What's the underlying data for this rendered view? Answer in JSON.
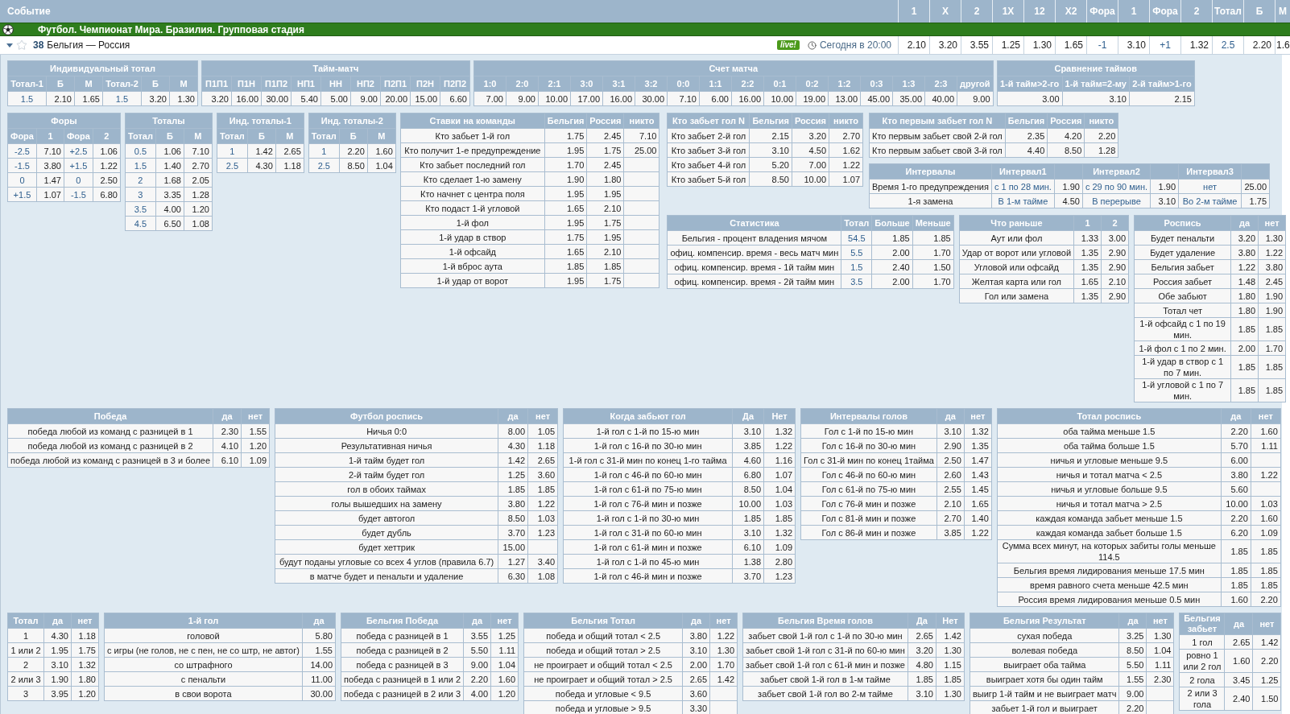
{
  "header": {
    "title": "Событие",
    "columns": [
      "1",
      "X",
      "2",
      "1X",
      "12",
      "X2",
      "Фора",
      "1",
      "Фора",
      "2",
      "Тотал",
      "Б",
      "М"
    ]
  },
  "league": {
    "name": "Футбол. Чемпионат Мира. Бразилия. Групповая стадия"
  },
  "event": {
    "expanded": true,
    "favorite": false,
    "number": "38",
    "teams": "Бельгия — Россия",
    "live": "live!",
    "time": "Сегодня в 20:00",
    "odds": [
      {
        "value": "2.10",
        "kind": "odds"
      },
      {
        "value": "3.20",
        "kind": "odds"
      },
      {
        "value": "3.55",
        "kind": "odds"
      },
      {
        "value": "1.25",
        "kind": "odds"
      },
      {
        "value": "1.30",
        "kind": "odds"
      },
      {
        "value": "1.65",
        "kind": "odds"
      },
      {
        "value": "-1",
        "kind": "param"
      },
      {
        "value": "3.10",
        "kind": "odds"
      },
      {
        "value": "+1",
        "kind": "param"
      },
      {
        "value": "1.32",
        "kind": "odds"
      },
      {
        "value": "2.5",
        "kind": "param"
      },
      {
        "value": "2.20",
        "kind": "odds"
      },
      {
        "value": "1.6",
        "kind": "odds"
      }
    ]
  },
  "markets": [
    {
      "title": "Индивидуальный тотал",
      "kind": "stacked",
      "columns": [
        {
          "label": "Тотал-1",
          "kind": "param"
        },
        {
          "label": "Б",
          "kind": "odds"
        },
        {
          "label": "М",
          "kind": "odds"
        },
        {
          "label": "Тотал-2",
          "kind": "param"
        },
        {
          "label": "Б",
          "kind": "odds"
        },
        {
          "label": "М",
          "kind": "odds"
        }
      ],
      "rows": [
        [
          "1.5",
          "2.10",
          "1.65",
          "1.5",
          "3.20",
          "1.30"
        ]
      ]
    },
    {
      "title": "Тайм-матч",
      "kind": "stacked",
      "columns": [
        {
          "label": "П1П1",
          "kind": "odds"
        },
        {
          "label": "П1Н",
          "kind": "odds"
        },
        {
          "label": "П1П2",
          "kind": "odds"
        },
        {
          "label": "НП1",
          "kind": "odds"
        },
        {
          "label": "НН",
          "kind": "odds"
        },
        {
          "label": "НП2",
          "kind": "odds"
        },
        {
          "label": "П2П1",
          "kind": "odds"
        },
        {
          "label": "П2Н",
          "kind": "odds"
        },
        {
          "label": "П2П2",
          "kind": "odds"
        }
      ],
      "rows": [
        [
          "3.20",
          "16.00",
          "30.00",
          "5.40",
          "5.00",
          "9.00",
          "20.00",
          "15.00",
          "6.60"
        ]
      ]
    },
    {
      "title": "Счет матча",
      "kind": "stacked",
      "columns": [
        {
          "label": "1:0",
          "kind": "odds"
        },
        {
          "label": "2:0",
          "kind": "odds"
        },
        {
          "label": "2:1",
          "kind": "odds"
        },
        {
          "label": "3:0",
          "kind": "odds"
        },
        {
          "label": "3:1",
          "kind": "odds"
        },
        {
          "label": "3:2",
          "kind": "odds"
        },
        {
          "label": "0:0",
          "kind": "odds"
        },
        {
          "label": "1:1",
          "kind": "odds"
        },
        {
          "label": "2:2",
          "kind": "odds"
        },
        {
          "label": "0:1",
          "kind": "odds"
        },
        {
          "label": "0:2",
          "kind": "odds"
        },
        {
          "label": "1:2",
          "kind": "odds"
        },
        {
          "label": "0:3",
          "kind": "odds"
        },
        {
          "label": "1:3",
          "kind": "odds"
        },
        {
          "label": "2:3",
          "kind": "odds"
        },
        {
          "label": "другой",
          "kind": "odds"
        }
      ],
      "rows": [
        [
          "7.00",
          "9.00",
          "10.00",
          "17.00",
          "16.00",
          "30.00",
          "7.10",
          "6.00",
          "16.00",
          "10.00",
          "19.00",
          "13.00",
          "45.00",
          "35.00",
          "40.00",
          "9.00"
        ]
      ]
    },
    {
      "title": "Сравнение таймов",
      "kind": "stacked",
      "columns": [
        {
          "label": "1-й тайм>2-го",
          "kind": "odds"
        },
        {
          "label": "1-й тайм=2-му",
          "kind": "odds"
        },
        {
          "label": "2-й тайм>1-го",
          "kind": "odds"
        }
      ],
      "rows": [
        [
          "3.00",
          "3.10",
          "2.15"
        ]
      ]
    },
    {
      "title": "Форы",
      "kind": "stacked",
      "columns": [
        {
          "label": "Фора",
          "kind": "param"
        },
        {
          "label": "1",
          "kind": "odds"
        },
        {
          "label": "Фора",
          "kind": "param"
        },
        {
          "label": "2",
          "kind": "odds"
        }
      ],
      "rows": [
        [
          "-2.5",
          "7.10",
          "+2.5",
          "1.06"
        ],
        [
          "-1.5",
          "3.80",
          "+1.5",
          "1.22"
        ],
        [
          "0",
          "1.47",
          "0",
          "2.50"
        ],
        [
          "+1.5",
          "1.07",
          "-1.5",
          "6.80"
        ]
      ]
    },
    {
      "title": "Тоталы",
      "kind": "stacked",
      "columns": [
        {
          "label": "Тотал",
          "kind": "param"
        },
        {
          "label": "Б",
          "kind": "odds"
        },
        {
          "label": "М",
          "kind": "odds"
        }
      ],
      "rows": [
        [
          "0.5",
          "1.06",
          "7.10"
        ],
        [
          "1.5",
          "1.40",
          "2.70"
        ],
        [
          "2",
          "1.68",
          "2.05"
        ],
        [
          "3",
          "3.35",
          "1.28"
        ],
        [
          "3.5",
          "4.00",
          "1.20"
        ],
        [
          "4.5",
          "6.50",
          "1.08"
        ]
      ]
    },
    {
      "title": "Инд. тоталы-1",
      "kind": "stacked",
      "columns": [
        {
          "label": "Тотал",
          "kind": "param"
        },
        {
          "label": "Б",
          "kind": "odds"
        },
        {
          "label": "М",
          "kind": "odds"
        }
      ],
      "rows": [
        [
          "1",
          "1.42",
          "2.65"
        ],
        [
          "2.5",
          "4.30",
          "1.18"
        ]
      ]
    },
    {
      "title": "Инд. тоталы-2",
      "kind": "stacked",
      "columns": [
        {
          "label": "Тотал",
          "kind": "param"
        },
        {
          "label": "Б",
          "kind": "odds"
        },
        {
          "label": "М",
          "kind": "odds"
        }
      ],
      "rows": [
        [
          "1",
          "2.20",
          "1.60"
        ],
        [
          "2.5",
          "8.50",
          "1.04"
        ]
      ]
    },
    {
      "title": "Ставки на команды",
      "kind": "inline",
      "columns": [
        {
          "label": "Бельгия",
          "kind": "odds"
        },
        {
          "label": "Россия",
          "kind": "odds"
        },
        {
          "label": "никто",
          "kind": "odds"
        }
      ],
      "rows": [
        {
          "label": "Кто забьет 1-й гол",
          "cells": [
            "1.75",
            "2.45",
            "7.10"
          ]
        },
        {
          "label": "Кто получит 1-е предупреждение",
          "cells": [
            "1.95",
            "1.75",
            "25.00"
          ]
        },
        {
          "label": "Кто забьет последний гол",
          "cells": [
            "1.70",
            "2.45",
            null
          ]
        },
        {
          "label": "Кто сделает 1-ю замену",
          "cells": [
            "1.90",
            "1.80",
            null
          ]
        },
        {
          "label": "Кто начнет с центра поля",
          "cells": [
            "1.95",
            "1.95",
            null
          ]
        },
        {
          "label": "Кто подаст 1-й угловой",
          "cells": [
            "1.65",
            "2.10",
            null
          ]
        },
        {
          "label": "1-й фол",
          "cells": [
            "1.95",
            "1.75",
            null
          ]
        },
        {
          "label": "1-й удар в створ",
          "cells": [
            "1.75",
            "1.95",
            null
          ]
        },
        {
          "label": "1-й офсайд",
          "cells": [
            "1.65",
            "2.10",
            null
          ]
        },
        {
          "label": "1-й вброс аута",
          "cells": [
            "1.85",
            "1.85",
            null
          ]
        },
        {
          "label": "1-й удар от ворот",
          "cells": [
            "1.95",
            "1.75",
            null
          ]
        }
      ]
    },
    {
      "title": "Кто забьет гол N",
      "kind": "inline",
      "columns": [
        {
          "label": "Бельгия",
          "kind": "odds"
        },
        {
          "label": "Россия",
          "kind": "odds"
        },
        {
          "label": "никто",
          "kind": "odds"
        }
      ],
      "rows": [
        {
          "label": "Кто забьет 2-й гол",
          "cells": [
            "2.15",
            "3.20",
            "2.70"
          ]
        },
        {
          "label": "Кто забьет 3-й гол",
          "cells": [
            "3.10",
            "4.50",
            "1.62"
          ]
        },
        {
          "label": "Кто забьет 4-й гол",
          "cells": [
            "5.20",
            "7.00",
            "1.22"
          ]
        },
        {
          "label": "Кто забьет 5-й гол",
          "cells": [
            "8.50",
            "10.00",
            "1.07"
          ]
        }
      ]
    },
    {
      "title": "Кто первым забьет гол N",
      "kind": "inline",
      "columns": [
        {
          "label": "Бельгия",
          "kind": "odds"
        },
        {
          "label": "Россия",
          "kind": "odds"
        },
        {
          "label": "никто",
          "kind": "odds"
        }
      ],
      "rows": [
        {
          "label": "Кто первым забьет свой 2-й гол",
          "cells": [
            "2.35",
            "4.20",
            "2.20"
          ]
        },
        {
          "label": "Кто первым забьет свой 3-й гол",
          "cells": [
            "4.40",
            "8.50",
            "1.28"
          ]
        }
      ]
    },
    {
      "title": "Интервалы",
      "kind": "inline",
      "columns": [
        {
          "label": "Интервал1",
          "kind": "param"
        },
        {
          "kind": "odds"
        },
        {
          "label": "Интервал2",
          "kind": "param"
        },
        {
          "kind": "odds"
        },
        {
          "label": "Интервал3",
          "kind": "param"
        },
        {
          "kind": "odds"
        }
      ],
      "rows": [
        {
          "label": "Время 1-го предупреждения",
          "cells": [
            "с 1 по 28 мин.",
            "1.90",
            "с 29 по 90 мин.",
            "1.90",
            "нет",
            "25.00"
          ]
        },
        {
          "label": "1-я замена",
          "cells": [
            "В 1-м тайме",
            "4.50",
            "В перерыве",
            "3.10",
            "Во 2-м тайме",
            "1.75"
          ]
        }
      ]
    },
    {
      "title": "Статистика",
      "kind": "inline",
      "columns": [
        {
          "label": "Тотал",
          "kind": "param"
        },
        {
          "label": "Больше",
          "kind": "odds"
        },
        {
          "label": "Меньше",
          "kind": "odds"
        }
      ],
      "rows": [
        {
          "label": "Бельгия - процент владения мячом",
          "cells": [
            "54.5",
            "1.85",
            "1.85"
          ]
        },
        {
          "label": "офиц. компенсир. время - весь матч мин",
          "cells": [
            "5.5",
            "2.00",
            "1.70"
          ]
        },
        {
          "label": "офиц. компенсир. время - 1й тайм мин",
          "cells": [
            "1.5",
            "2.40",
            "1.50"
          ]
        },
        {
          "label": "офиц. компенсир. время - 2й тайм мин",
          "cells": [
            "3.5",
            "2.00",
            "1.70"
          ]
        }
      ]
    },
    {
      "title": "Что раньше",
      "kind": "inline",
      "columns": [
        {
          "label": "1",
          "kind": "odds"
        },
        {
          "label": "2",
          "kind": "odds"
        }
      ],
      "rows": [
        {
          "label": "Аут или фол",
          "cells": [
            "1.33",
            "3.00"
          ]
        },
        {
          "label": "Удар от ворот или угловой",
          "cells": [
            "1.35",
            "2.90"
          ]
        },
        {
          "label": "Угловой или офсайд",
          "cells": [
            "1.35",
            "2.90"
          ]
        },
        {
          "label": "Желтая карта или гол",
          "cells": [
            "1.65",
            "2.10"
          ]
        },
        {
          "label": "Гол или замена",
          "cells": [
            "1.35",
            "2.90"
          ]
        }
      ]
    },
    {
      "title": "Роспись",
      "kind": "inline",
      "columns": [
        {
          "label": "да",
          "kind": "odds"
        },
        {
          "label": "нет",
          "kind": "odds"
        }
      ],
      "rows": [
        {
          "label": "Будет пенальти",
          "cells": [
            "3.20",
            "1.30"
          ]
        },
        {
          "label": "Будет удаление",
          "cells": [
            "3.80",
            "1.22"
          ]
        },
        {
          "label": "Бельгия забьет",
          "cells": [
            "1.22",
            "3.80"
          ]
        },
        {
          "label": "Россия забьет",
          "cells": [
            "1.48",
            "2.45"
          ]
        },
        {
          "label": "Обе забьют",
          "cells": [
            "1.80",
            "1.90"
          ]
        },
        {
          "label": "Тотал чет",
          "cells": [
            "1.80",
            "1.90"
          ]
        },
        {
          "label": "1-й офсайд с 1 по 19 мин.",
          "cells": [
            "1.85",
            "1.85"
          ]
        },
        {
          "label": "1-й фол с 1 по 2 мин.",
          "cells": [
            "2.00",
            "1.70"
          ]
        },
        {
          "label": "1-й удар в створ с 1 по 7 мин.",
          "cells": [
            "1.85",
            "1.85"
          ]
        },
        {
          "label": "1-й угловой с 1 по 7 мин.",
          "cells": [
            "1.85",
            "1.85"
          ]
        }
      ]
    },
    {
      "title": "Победа",
      "kind": "inline",
      "columns": [
        {
          "label": "да",
          "kind": "odds"
        },
        {
          "label": "нет",
          "kind": "odds"
        }
      ],
      "rows": [
        {
          "label": "победа любой из команд с разницей в 1",
          "cells": [
            "2.30",
            "1.55"
          ]
        },
        {
          "label": "победа любой из команд с разницей в 2",
          "cells": [
            "4.10",
            "1.20"
          ]
        },
        {
          "label": "победа любой из команд с разницей в 3 и более",
          "cells": [
            "6.10",
            "1.09"
          ]
        }
      ]
    },
    {
      "title": "Футбол роспись",
      "kind": "inline",
      "columns": [
        {
          "label": "да",
          "kind": "odds"
        },
        {
          "label": "нет",
          "kind": "odds"
        }
      ],
      "rows": [
        {
          "label": "Ничья 0:0",
          "cells": [
            "8.00",
            "1.05"
          ]
        },
        {
          "label": "Результативная ничья",
          "cells": [
            "4.30",
            "1.18"
          ]
        },
        {
          "label": "1-й тайм будет гол",
          "cells": [
            "1.42",
            "2.65"
          ]
        },
        {
          "label": "2-й тайм будет гол",
          "cells": [
            "1.25",
            "3.60"
          ]
        },
        {
          "label": "гол в обоих таймах",
          "cells": [
            "1.85",
            "1.85"
          ]
        },
        {
          "label": "голы вышедших на замену",
          "cells": [
            "3.80",
            "1.22"
          ]
        },
        {
          "label": "будет автогол",
          "cells": [
            "8.50",
            "1.03"
          ]
        },
        {
          "label": "будет дубль",
          "cells": [
            "3.70",
            "1.23"
          ]
        },
        {
          "label": "будет хеттрик",
          "cells": [
            "15.00",
            null
          ]
        },
        {
          "label": "будут поданы угловые со всех 4 углов (правила 6.7)",
          "cells": [
            "1.27",
            "3.40"
          ]
        },
        {
          "label": "в матче будет и пенальти и удаление",
          "cells": [
            "6.30",
            "1.08"
          ]
        }
      ]
    },
    {
      "title": "Когда забьют гол",
      "kind": "inline",
      "columns": [
        {
          "label": "Да",
          "kind": "odds"
        },
        {
          "label": "Нет",
          "kind": "odds"
        }
      ],
      "rows": [
        {
          "label": "1-й гол с 1-й по 15-ю мин",
          "cells": [
            "3.10",
            "1.32"
          ]
        },
        {
          "label": "1-й гол с 16-й по 30-ю мин",
          "cells": [
            "3.85",
            "1.22"
          ]
        },
        {
          "label": "1-й гол с 31-й мин по конец 1-го тайма",
          "cells": [
            "4.60",
            "1.16"
          ]
        },
        {
          "label": "1-й гол с 46-й по 60-ю мин",
          "cells": [
            "6.80",
            "1.07"
          ]
        },
        {
          "label": "1-й гол с 61-й по 75-ю мин",
          "cells": [
            "8.50",
            "1.04"
          ]
        },
        {
          "label": "1-й гол с 76-й мин и позже",
          "cells": [
            "10.00",
            "1.03"
          ]
        },
        {
          "label": "1-й гол с 1-й по 30-ю мин",
          "cells": [
            "1.85",
            "1.85"
          ]
        },
        {
          "label": "1-й гол с 31-й по 60-ю мин",
          "cells": [
            "3.10",
            "1.32"
          ]
        },
        {
          "label": "1-й гол с 61-й мин и позже",
          "cells": [
            "6.10",
            "1.09"
          ]
        },
        {
          "label": "1-й гол с 1-й по 45-ю мин",
          "cells": [
            "1.38",
            "2.80"
          ]
        },
        {
          "label": "1-й гол с 46-й мин и позже",
          "cells": [
            "3.70",
            "1.23"
          ]
        }
      ]
    },
    {
      "title": "Интервалы голов",
      "kind": "inline",
      "columns": [
        {
          "label": "да",
          "kind": "odds"
        },
        {
          "label": "нет",
          "kind": "odds"
        }
      ],
      "rows": [
        {
          "label": "Гол с 1-й по 15-ю мин",
          "cells": [
            "3.10",
            "1.32"
          ]
        },
        {
          "label": "Гол с 16-й по 30-ю мин",
          "cells": [
            "2.90",
            "1.35"
          ]
        },
        {
          "label": "Гол с 31-й мин по конец 1тайма",
          "cells": [
            "2.50",
            "1.47"
          ]
        },
        {
          "label": "Гол с 46-й по 60-ю мин",
          "cells": [
            "2.60",
            "1.43"
          ]
        },
        {
          "label": "Гол с 61-й по 75-ю мин",
          "cells": [
            "2.55",
            "1.45"
          ]
        },
        {
          "label": "Гол с 76-й мин и позже",
          "cells": [
            "2.10",
            "1.65"
          ]
        },
        {
          "label": "Гол с 81-й мин и позже",
          "cells": [
            "2.70",
            "1.40"
          ]
        },
        {
          "label": "Гол с 86-й мин и позже",
          "cells": [
            "3.85",
            "1.22"
          ]
        }
      ]
    },
    {
      "title": "Тотал роспись",
      "kind": "inline",
      "columns": [
        {
          "label": "да",
          "kind": "odds"
        },
        {
          "label": "нет",
          "kind": "odds"
        }
      ],
      "rows": [
        {
          "label": "оба тайма меньше 1.5",
          "cells": [
            "2.20",
            "1.60"
          ]
        },
        {
          "label": "оба тайма больше 1.5",
          "cells": [
            "5.70",
            "1.11"
          ]
        },
        {
          "label": "ничья и угловые меньше 9.5",
          "cells": [
            "6.00",
            null
          ]
        },
        {
          "label": "ничья и тотал матча < 2.5",
          "cells": [
            "3.80",
            "1.22"
          ]
        },
        {
          "label": "ничья и угловые больше 9.5",
          "cells": [
            "5.60",
            null
          ]
        },
        {
          "label": "ничья и тотал матча > 2.5",
          "cells": [
            "10.00",
            "1.03"
          ]
        },
        {
          "label": "каждая команда забьет меньше 1.5",
          "cells": [
            "2.20",
            "1.60"
          ]
        },
        {
          "label": "каждая команда забьет больше 1.5",
          "cells": [
            "6.20",
            "1.09"
          ]
        },
        {
          "label": "Сумма всех минут, на которых забиты голы меньше 114.5",
          "cells": [
            "1.85",
            "1.85"
          ]
        },
        {
          "label": "Бельгия время лидирования меньше 17.5 мин",
          "cells": [
            "1.85",
            "1.85"
          ]
        },
        {
          "label": "время равного счета меньше 42.5 мин",
          "cells": [
            "1.85",
            "1.85"
          ]
        },
        {
          "label": "Россия время лидирования меньше 0.5 мин",
          "cells": [
            "1.60",
            "2.20"
          ]
        }
      ]
    },
    {
      "title": "Тотал",
      "kind": "inline",
      "columns": [
        {
          "label": "да",
          "kind": "odds"
        },
        {
          "label": "нет",
          "kind": "odds"
        }
      ],
      "rows": [
        {
          "label": "1",
          "cells": [
            "4.30",
            "1.18"
          ]
        },
        {
          "label": "1 или 2",
          "cells": [
            "1.95",
            "1.75"
          ]
        },
        {
          "label": "2",
          "cells": [
            "3.10",
            "1.32"
          ]
        },
        {
          "label": "2 или 3",
          "cells": [
            "1.90",
            "1.80"
          ]
        },
        {
          "label": "3",
          "cells": [
            "3.95",
            "1.20"
          ]
        }
      ]
    },
    {
      "title": "1-й гол",
      "kind": "inline",
      "columns": [
        {
          "label": "да",
          "kind": "odds"
        }
      ],
      "rows": [
        {
          "label": "головой",
          "cells": [
            "5.80"
          ]
        },
        {
          "label": "с игры (не голов, не с пен, не со штр, не автог)",
          "cells": [
            "1.55"
          ]
        },
        {
          "label": "со штрафного",
          "cells": [
            "14.00"
          ]
        },
        {
          "label": "с пенальти",
          "cells": [
            "11.00"
          ]
        },
        {
          "label": "в свои ворота",
          "cells": [
            "30.00"
          ]
        }
      ]
    },
    {
      "title": "Бельгия Победа",
      "kind": "inline",
      "columns": [
        {
          "label": "да",
          "kind": "odds"
        },
        {
          "label": "нет",
          "kind": "odds"
        }
      ],
      "rows": [
        {
          "label": "победа с разницей в 1",
          "cells": [
            "3.55",
            "1.25"
          ]
        },
        {
          "label": "победа с разницей в 2",
          "cells": [
            "5.50",
            "1.11"
          ]
        },
        {
          "label": "победа с разницей в 3",
          "cells": [
            "9.00",
            "1.04"
          ]
        },
        {
          "label": "победа с разницей в 1 или 2",
          "cells": [
            "2.20",
            "1.60"
          ]
        },
        {
          "label": "победа с разницей в 2 или 3",
          "cells": [
            "4.00",
            "1.20"
          ]
        }
      ]
    },
    {
      "title": "Бельгия Тотал",
      "kind": "inline",
      "columns": [
        {
          "label": "да",
          "kind": "odds"
        },
        {
          "label": "нет",
          "kind": "odds"
        }
      ],
      "rows": [
        {
          "label": "победа и общий тотал < 2.5",
          "cells": [
            "3.80",
            "1.22"
          ]
        },
        {
          "label": "победа и общий тотал > 2.5",
          "cells": [
            "3.10",
            "1.30"
          ]
        },
        {
          "label": "не проиграет и общий тотал < 2.5",
          "cells": [
            "2.00",
            "1.70"
          ]
        },
        {
          "label": "не проиграет и общий тотал > 2.5",
          "cells": [
            "2.65",
            "1.42"
          ]
        },
        {
          "label": "победа и угловые < 9.5",
          "cells": [
            "3.60",
            null
          ]
        },
        {
          "label": "победа и угловые > 9.5",
          "cells": [
            "3.30",
            null
          ]
        }
      ]
    },
    {
      "title": "Бельгия Время голов",
      "kind": "inline",
      "columns": [
        {
          "label": "Да",
          "kind": "odds"
        },
        {
          "label": "Нет",
          "kind": "odds"
        }
      ],
      "rows": [
        {
          "label": "забьет свой 1-й гол с 1-й по 30-ю мин",
          "cells": [
            "2.65",
            "1.42"
          ]
        },
        {
          "label": "забьет свой 1-й гол с 31-й по 60-ю мин",
          "cells": [
            "3.20",
            "1.30"
          ]
        },
        {
          "label": "забьет свой 1-й гол с 61-й мин и позже",
          "cells": [
            "4.80",
            "1.15"
          ]
        },
        {
          "label": "забьет свой 1-й гол в 1-м тайме",
          "cells": [
            "1.85",
            "1.85"
          ]
        },
        {
          "label": "забьет свой 1-й гол во 2-м тайме",
          "cells": [
            "3.10",
            "1.30"
          ]
        }
      ]
    },
    {
      "title": "Бельгия Результат",
      "kind": "inline",
      "columns": [
        {
          "label": "да",
          "kind": "odds"
        },
        {
          "label": "нет",
          "kind": "odds"
        }
      ],
      "rows": [
        {
          "label": "сухая победа",
          "cells": [
            "3.25",
            "1.30"
          ]
        },
        {
          "label": "волевая победа",
          "cells": [
            "8.50",
            "1.04"
          ]
        },
        {
          "label": "выиграет оба тайма",
          "cells": [
            "5.50",
            "1.11"
          ]
        },
        {
          "label": "выиграет хотя бы один тайм",
          "cells": [
            "1.55",
            "2.30"
          ]
        },
        {
          "label": "выигр 1-й тайм и не выиграет матч",
          "cells": [
            "9.00",
            null
          ]
        },
        {
          "label": "забьет 1-й гол и выиграет",
          "cells": [
            "2.20",
            null
          ]
        }
      ]
    },
    {
      "title": "Бельгия забьет",
      "kind": "inline",
      "columns": [
        {
          "label": "да",
          "kind": "odds"
        },
        {
          "label": "нет",
          "kind": "odds"
        }
      ],
      "rows": [
        {
          "label": "1 гол",
          "cells": [
            "2.65",
            "1.42"
          ]
        },
        {
          "label": "ровно 1 или 2 гол",
          "cells": [
            "1.60",
            "2.20"
          ]
        },
        {
          "label": "2 гола",
          "cells": [
            "3.45",
            "1.25"
          ]
        },
        {
          "label": "2 или 3 гола",
          "cells": [
            "2.40",
            "1.50"
          ]
        }
      ]
    }
  ]
}
